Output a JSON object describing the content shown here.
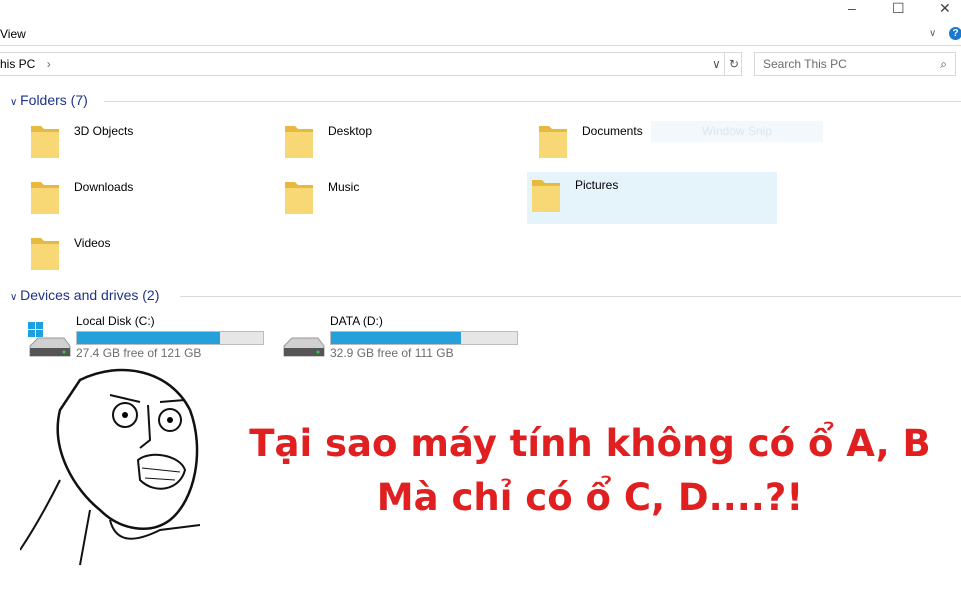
{
  "window": {
    "minimize": "–",
    "maximize": "☐",
    "close": "✕"
  },
  "ribbon": {
    "view_tab": "View",
    "help": "?"
  },
  "address": {
    "path": "his PC",
    "separator": "›"
  },
  "search": {
    "placeholder": "Search This PC"
  },
  "folders": {
    "header": "Folders (7)",
    "items": [
      {
        "label": "3D Objects",
        "icon": "3d-objects-icon"
      },
      {
        "label": "Desktop",
        "icon": "desktop-icon"
      },
      {
        "label": "Documents",
        "icon": "documents-icon"
      },
      {
        "label": "Downloads",
        "icon": "downloads-icon"
      },
      {
        "label": "Music",
        "icon": "music-icon"
      },
      {
        "label": "Pictures",
        "icon": "pictures-icon"
      },
      {
        "label": "Videos",
        "icon": "videos-icon"
      }
    ]
  },
  "ghost": "Window Snip",
  "drives": {
    "header": "Devices and drives (2)",
    "items": [
      {
        "label": "Local Disk (C:)",
        "free": "27.4 GB free of 121 GB",
        "used_percent": 77
      },
      {
        "label": "DATA (D:)",
        "free": "32.9 GB free of 111 GB",
        "used_percent": 70
      }
    ]
  },
  "caption": {
    "line1": "Tại sao máy tính không có ổ A, B",
    "line2": "Mà chỉ có ổ C, D....?!"
  },
  "colors": {
    "accent": "#26a0da",
    "caption": "#e02020",
    "group": "#1e3287"
  }
}
